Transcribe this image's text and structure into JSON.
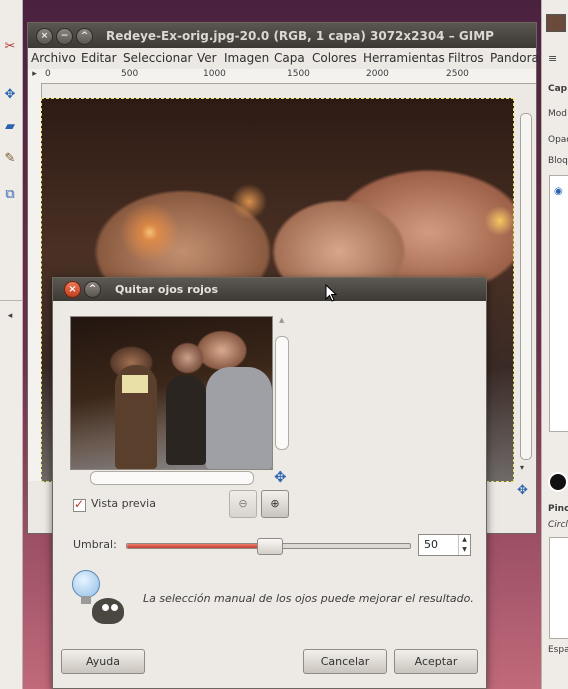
{
  "image_window": {
    "title": "Redeye-Ex-orig.jpg-20.0 (RGB, 1 capa) 3072x2304 – GIMP",
    "menu": [
      "Archivo",
      "Editar",
      "Seleccionar",
      "Ver",
      "Imagen",
      "Capa",
      "Colores",
      "Herramientas",
      "Filtros",
      "Pandora"
    ],
    "ruler_ticks": [
      "0",
      "500",
      "1000",
      "1500",
      "2000",
      "2500"
    ]
  },
  "dock": {
    "labels": [
      "Cap",
      "Mod",
      "Opac",
      "Bloq",
      "Pinc",
      "Circl",
      "Espa"
    ]
  },
  "dialog": {
    "title": "Quitar ojos rojos",
    "preview_label": "Vista previa",
    "preview_checked": true,
    "threshold_label": "Umbral:",
    "threshold_value": "50",
    "threshold_fraction": 0.5,
    "hint": "La selección manual de los ojos puede mejorar el resultado.",
    "buttons": {
      "help": "Ayuda",
      "cancel": "Cancelar",
      "ok": "Aceptar"
    }
  },
  "colors": {
    "accent_red": "#c23f33",
    "titlebar": "#3d3a36"
  }
}
